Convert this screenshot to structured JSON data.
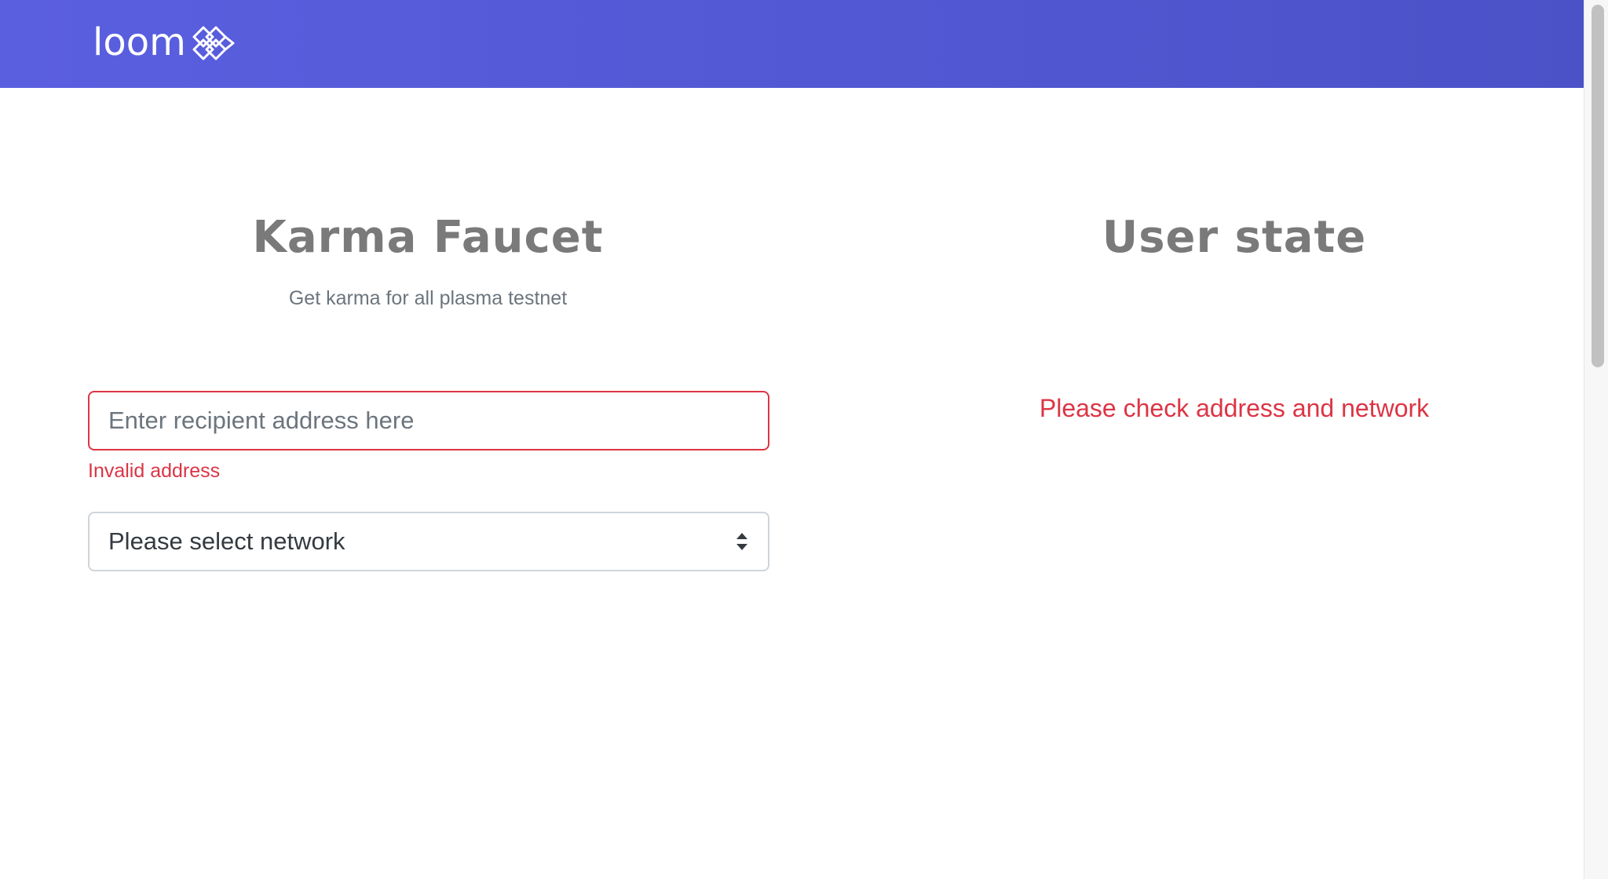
{
  "brand": {
    "name": "loom",
    "logo_icon": "loom-knot-icon"
  },
  "faucet": {
    "title": "Karma Faucet",
    "subtitle": "Get karma for all plasma testnet",
    "address_input": {
      "value": "",
      "placeholder": "Enter recipient address here"
    },
    "address_error": "Invalid address",
    "network_select": {
      "selected": "Please select network",
      "icon": "select-arrows-icon"
    }
  },
  "user_state": {
    "title": "User state",
    "message": "Please check address and network"
  },
  "colors": {
    "navbar_start": "#5a5fe0",
    "navbar_end": "#4b52c8",
    "error": "#dc3545",
    "heading": "#7a7a7a",
    "muted": "#6c757d"
  }
}
